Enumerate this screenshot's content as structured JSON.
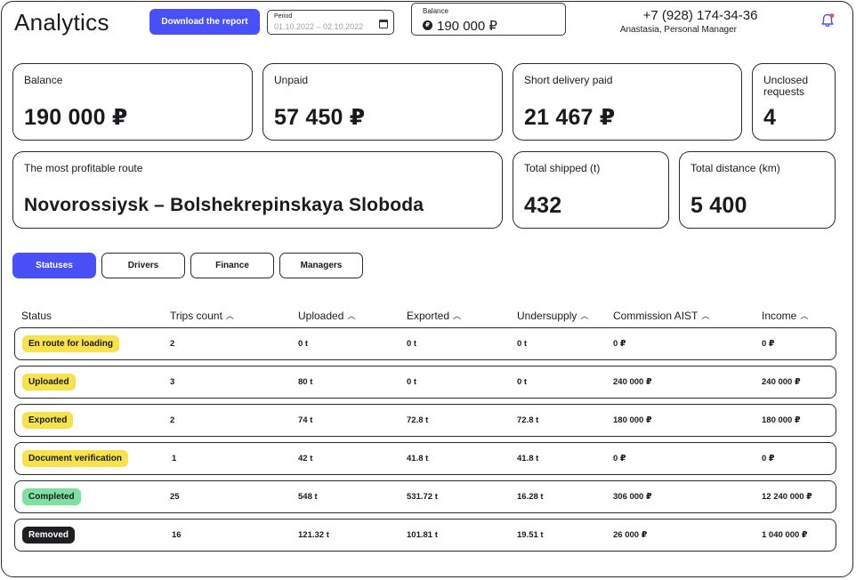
{
  "header": {
    "title": "Analytics",
    "download_label": "Download the report",
    "period_label": "Period",
    "period_value": "01.10.2022 – 02.10.2022",
    "balance_label": "Balance",
    "balance_value": "190 000 ₽",
    "currency_glyph": "₽",
    "phone": "+7 (928) 174-34-36",
    "manager": "Anastasia, Personal Manager",
    "notification_icon": "bell-icon",
    "notification_dot_color": "#f05050"
  },
  "cards": {
    "balance": {
      "label": "Balance",
      "value": "190 000 ₽"
    },
    "unpaid": {
      "label": "Unpaid",
      "value": "57 450 ₽"
    },
    "short_delivery": {
      "label": "Short delivery paid",
      "value": "21 467 ₽"
    },
    "unclosed": {
      "label": "Unclosed requests",
      "value": "4"
    },
    "route": {
      "label": "The most profitable route",
      "value": "Novorossiysk – Bolshekrepinskaya Sloboda"
    },
    "shipped": {
      "label": "Total shipped (t)",
      "value": "432"
    },
    "distance": {
      "label": "Total distance (km)",
      "value": "5 400"
    }
  },
  "tabs": [
    {
      "label": "Statuses",
      "active": true
    },
    {
      "label": "Drivers",
      "active": false
    },
    {
      "label": "Finance",
      "active": false
    },
    {
      "label": "Managers",
      "active": false
    }
  ],
  "table": {
    "sort_glyph": "︿",
    "columns": [
      "Status",
      "Trips count",
      "Uploaded",
      "Exported",
      "Undersupply",
      "Commission AIST",
      "Income"
    ],
    "rows": [
      {
        "status": "En route for loading",
        "trips": "2",
        "uploaded": "0 t",
        "exported": "0 t",
        "undersupply": "0 t",
        "commission": "0 ₽",
        "income": "0 ₽"
      },
      {
        "status": "Uploaded",
        "trips": "3",
        "uploaded": "80 t",
        "exported": "0 t",
        "undersupply": "0 t",
        "commission": "240 000 ₽",
        "income": "240 000 ₽"
      },
      {
        "status": "Exported",
        "trips": "2",
        "uploaded": "74 t",
        "exported": "72.8 t",
        "undersupply": "72.8 t",
        "commission": "180 000 ₽",
        "income": "180 000 ₽"
      },
      {
        "status": "Document verification",
        "trips": "1",
        "uploaded": "42 t",
        "exported": "41.8 t",
        "undersupply": "41.8 t",
        "commission": "0 ₽",
        "income": "0 ₽"
      },
      {
        "status": "Completed",
        "trips": "25",
        "uploaded": "548 t",
        "exported": "531.72 t",
        "undersupply": "16.28 t",
        "commission": "306 000 ₽",
        "income": "12 240 000 ₽"
      },
      {
        "status": "Removed",
        "trips": "16",
        "uploaded": "121.32 t",
        "exported": "101.81 t",
        "undersupply": "19.51 t",
        "commission": "26 000 ₽",
        "income": "1 040 000 ₽"
      }
    ]
  },
  "colors": {
    "accent": "#4a50f8",
    "badge_yellow": "#f6e24a",
    "badge_green": "#7fe0a0",
    "badge_dark": "#1f1f22"
  }
}
